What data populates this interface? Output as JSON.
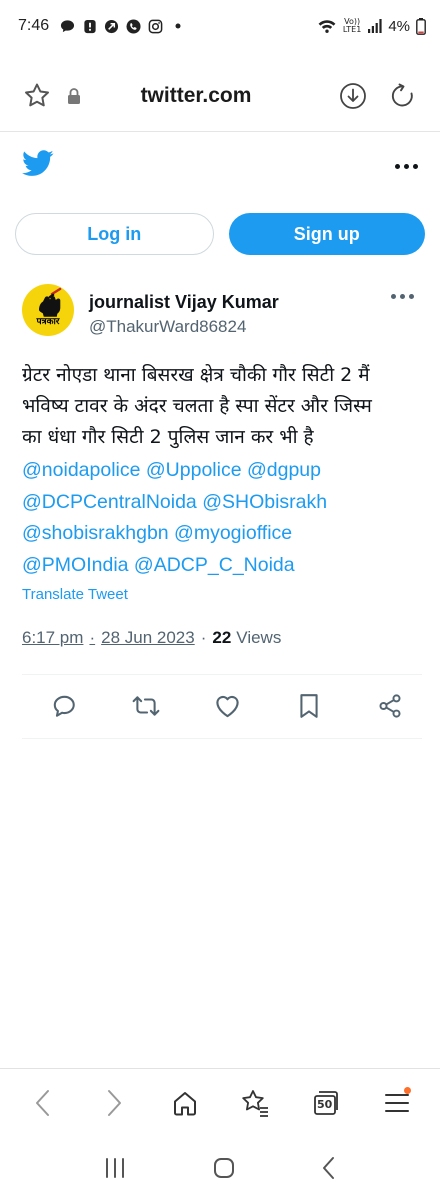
{
  "status": {
    "time": "7:46",
    "battery": "4%",
    "network": "LTE1",
    "volte": "Vo))"
  },
  "browser": {
    "url": "twitter.com",
    "tab_count": "50"
  },
  "auth": {
    "login_label": "Log in",
    "signup_label": "Sign up"
  },
  "tweet": {
    "author_name": "journalist Vijay Kumar",
    "author_handle": "@ThakurWard86824",
    "avatar_text": "पत्रकार",
    "text_lines": [
      "ग्रेटर नोएडा थाना बिसरख क्षेत्र चौकी गौर सिटी 2 मैं",
      "भविष्य टावर के अंदर चलता है स्पा सेंटर और जिस्म",
      "का धंधा गौर सिटी 2 पुलिस जान कर भी है"
    ],
    "mention_lines": [
      "@noidapolice @Uppolice @dgpup",
      "@DCPCentralNoida @SHObisrakh",
      "@shobisrakhgbn @myogioffice",
      "@PMOIndia @ADCP_C_Noida"
    ],
    "translate_label": "Translate Tweet",
    "time": "6:17 pm",
    "date": "28 Jun 2023",
    "views_count": "22",
    "views_label": "Views"
  },
  "colors": {
    "twitter_blue": "#1d9bf0",
    "text_primary": "#0f1419",
    "text_secondary": "#536471",
    "avatar_bg": "#f6d40b",
    "notification_dot": "#ff6f2c"
  },
  "icons": {
    "status": [
      "message-icon",
      "alert-icon",
      "shortcut-icon",
      "phone-icon",
      "instagram-icon",
      "dot-icon",
      "wifi-icon",
      "signal-icon",
      "battery-icon"
    ],
    "address_bar": [
      "star-icon",
      "lock-icon",
      "download-icon",
      "reload-icon"
    ],
    "actions": [
      "reply-icon",
      "retweet-icon",
      "like-icon",
      "bookmark-icon",
      "share-icon"
    ],
    "toolbar": [
      "back-icon",
      "forward-icon",
      "home-icon",
      "bookmarks-icon",
      "tabs-icon",
      "menu-icon"
    ]
  }
}
